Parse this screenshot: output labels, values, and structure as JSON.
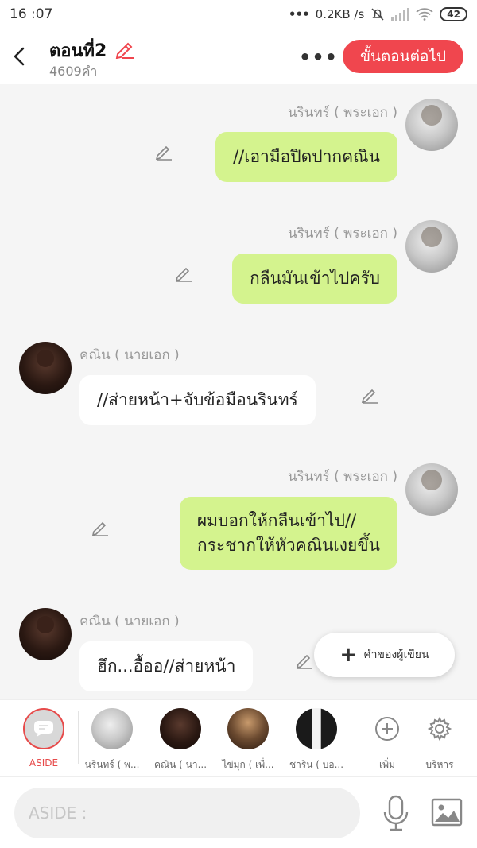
{
  "status_bar": {
    "time": "16 :07",
    "dots": "•••",
    "speed": "0.2KB /s",
    "battery": "42"
  },
  "header": {
    "title": "ตอนที่2",
    "word_count": "4609คำ",
    "more": "•••",
    "next_button": "ขั้นตอนต่อไป"
  },
  "messages": [
    {
      "side": "right",
      "sender": "นรินทร์ ( พระเอก )",
      "text": "//เอามือปิดปากคณิน"
    },
    {
      "side": "right",
      "sender": "นรินทร์ ( พระเอก )",
      "text": "กลืนมันเข้าไปครับ"
    },
    {
      "side": "left",
      "sender": "คณิน ( นายเอก )",
      "text": "//ส่ายหน้า+จับข้อมือนรินทร์"
    },
    {
      "side": "right",
      "sender": "นรินทร์ ( พระเอก )",
      "text_line1": "ผมบอกให้กลืนเข้าไป//",
      "text_line2": "กระชากให้หัวคณินเงยขึ้น"
    },
    {
      "side": "left",
      "sender": "คณิน ( นายเอก )",
      "text": "ฮึก...อื้ออ//ส่ายหน้า"
    }
  ],
  "fab": {
    "label": "คำของผู้เขียน"
  },
  "character_bar": {
    "aside": "ASIDE",
    "characters": [
      {
        "label": "นรินทร์ ( พ..."
      },
      {
        "label": "คณิน ( นา..."
      },
      {
        "label": "ไข่มุก ( เพื่..."
      },
      {
        "label": "ชาริน ( บอ..."
      }
    ],
    "add_label": "เพิ่ม",
    "manage_label": "บริหาร"
  },
  "input": {
    "placeholder": "ASIDE :"
  },
  "colors": {
    "accent": "#f0464e",
    "bubble_green": "#d4f38e",
    "bubble_white": "#ffffff"
  }
}
